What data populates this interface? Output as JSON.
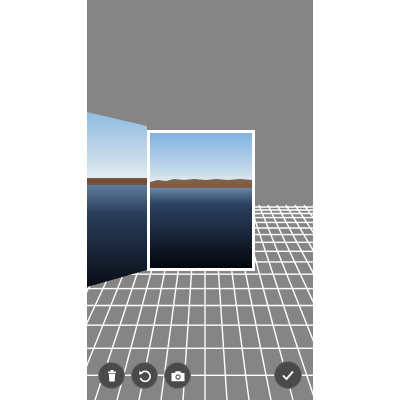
{
  "app": {
    "screen": "panorama-capture"
  },
  "toolbar": {
    "buttons": [
      {
        "id": "delete",
        "icon": "trash-icon"
      },
      {
        "id": "rotate",
        "icon": "rotate-ccw-icon"
      },
      {
        "id": "camera",
        "icon": "camera-icon"
      },
      {
        "id": "done",
        "icon": "check-icon"
      }
    ]
  },
  "colors": {
    "background": "#858585",
    "grid_line": "#ffffff",
    "frame_border": "#ffffff",
    "button_fill": "#4a4a4a",
    "sky_top": "#8fbfe6",
    "sky_horizon": "#e6eef2",
    "water": "#0d1b2e"
  }
}
